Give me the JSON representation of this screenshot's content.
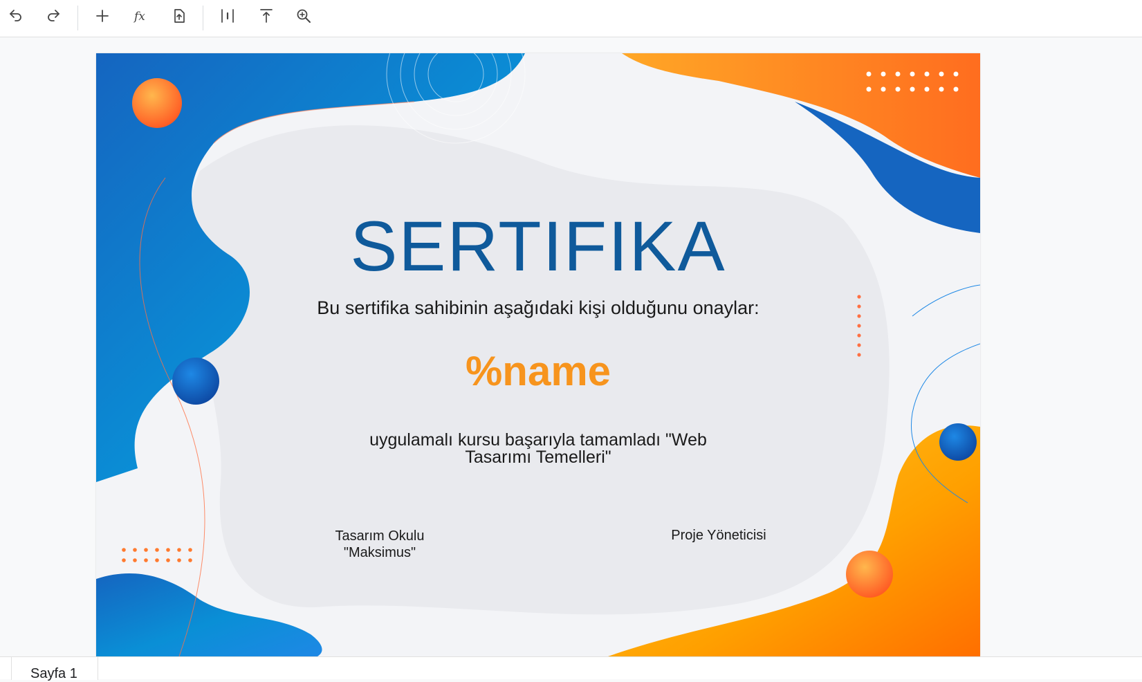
{
  "toolbar": {
    "buttons": [
      {
        "name": "undo-button",
        "icon": "undo-icon"
      },
      {
        "name": "redo-button",
        "icon": "redo-icon"
      },
      {
        "name": "add-button",
        "icon": "plus-icon"
      },
      {
        "name": "function-button",
        "icon": "fx-icon"
      },
      {
        "name": "export-button",
        "icon": "file-upload-icon"
      },
      {
        "name": "align-center-button",
        "icon": "align-center-icon"
      },
      {
        "name": "align-top-button",
        "icon": "align-top-icon"
      },
      {
        "name": "zoom-button",
        "icon": "zoom-in-icon"
      }
    ]
  },
  "certificate": {
    "title": "SERTIFIKA",
    "subtitle": "Bu sertifika sahibinin aşağıdaki kişi olduğunu onaylar:",
    "name_placeholder": "%name",
    "course_line1": "uygulamalı kursu başarıyla tamamladı \"Web",
    "course_line2": "Tasarımı Temelleri\"",
    "sign_left_line1": "Tasarım Okulu",
    "sign_left_line2": "\"Maksimus\"",
    "sign_right": "Proje Yöneticisi"
  },
  "sheet_tabs": [
    {
      "label": "Sayfa 1",
      "active": true
    }
  ],
  "colors": {
    "title_blue": "#0f5a9b",
    "name_orange": "#f7941d",
    "blue_shape": "#0a7fd0",
    "orange_shape": "#ff8a1f",
    "yellow_shape": "#ffc107"
  }
}
